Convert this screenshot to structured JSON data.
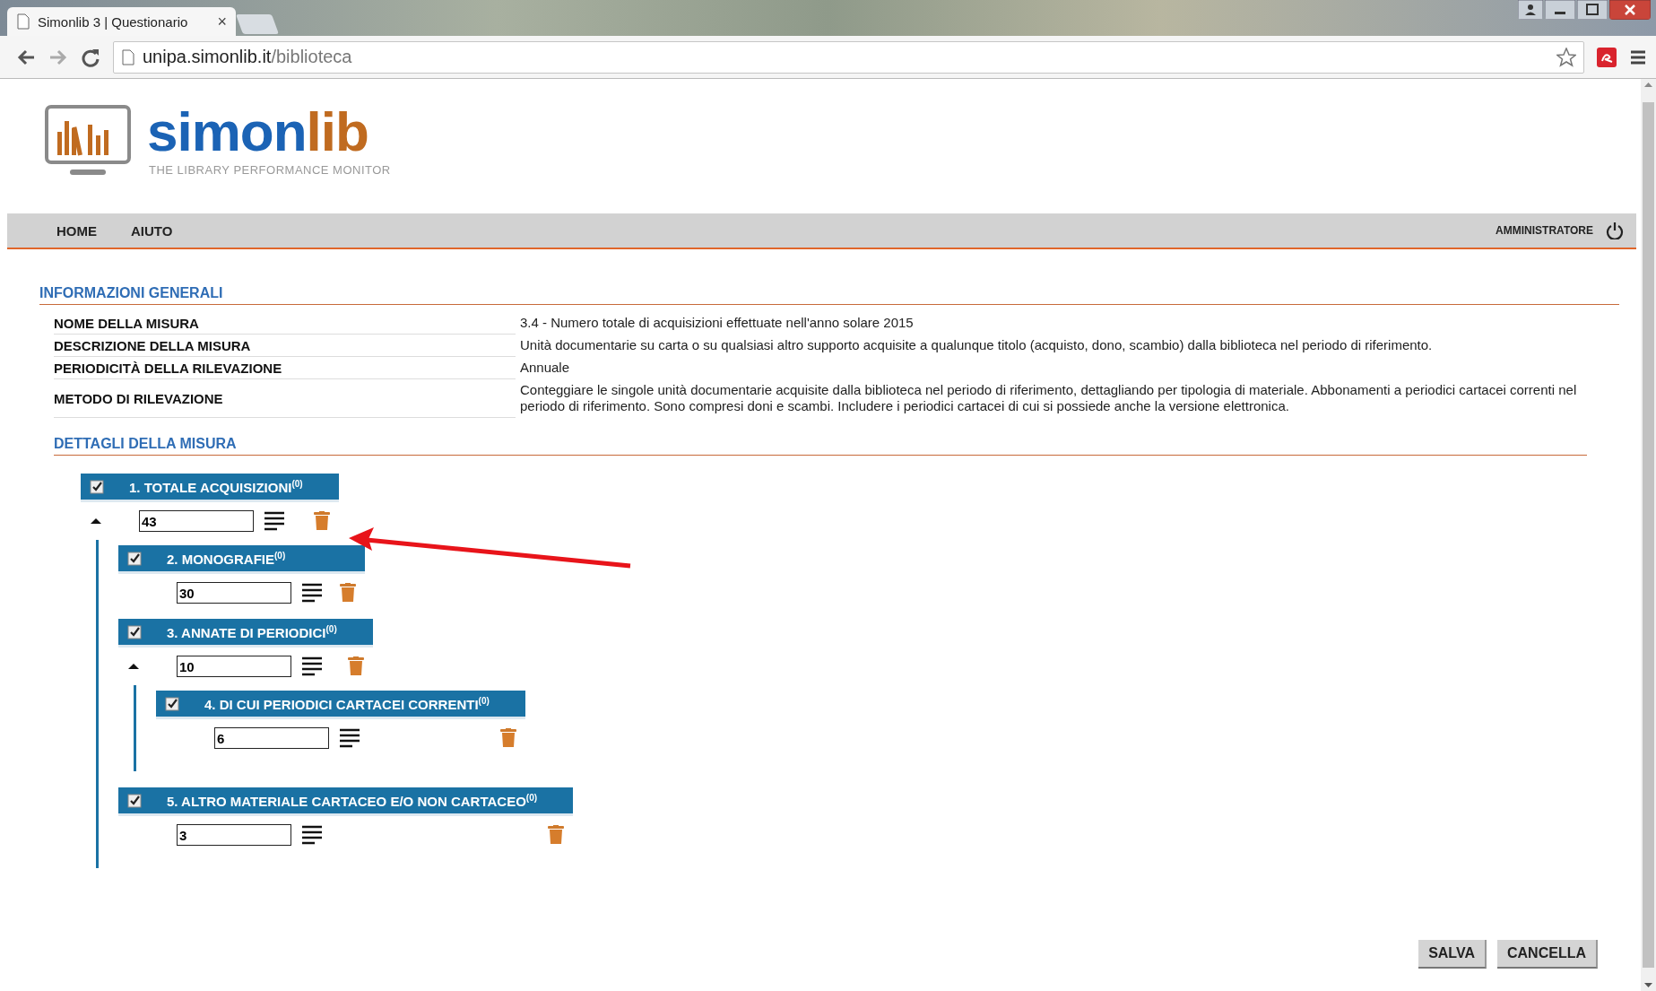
{
  "browser": {
    "tab_title": "Simonlib 3 | Questionario",
    "tab_close": "×",
    "url_host": "unipa.simonlib.it",
    "url_path": "/biblioteca"
  },
  "header": {
    "logo_primary": "simon",
    "logo_accent": "lib",
    "tagline": "THE LIBRARY PERFORMANCE MONITOR"
  },
  "nav": {
    "items": [
      "HOME",
      "AIUTO"
    ],
    "user": "AMMINISTRATORE"
  },
  "info": {
    "title": "INFORMAZIONI GENERALI",
    "rows": [
      {
        "label": "NOME DELLA MISURA",
        "value": "3.4 - Numero totale di acquisizioni effettuate nell'anno solare 2015"
      },
      {
        "label": "DESCRIZIONE DELLA MISURA",
        "value": "Unità documentarie su carta o su qualsiasi altro supporto acquisite a qualunque titolo (acquisto, dono, scambio) dalla biblioteca nel periodo di riferimento."
      },
      {
        "label": "PERIODICITÀ DELLA RILEVAZIONE",
        "value": "Annuale"
      },
      {
        "label": "METODO DI RILEVAZIONE",
        "value": "Conteggiare le singole unità documentarie acquisite dalla biblioteca nel periodo di riferimento, dettagliando per tipologia di materiale. Abbonamenti a periodici cartacei correnti nel periodo di riferimento. Sono compresi doni e scambi. Includere i periodici cartacei di cui si possiede anche la versione elettronica."
      }
    ]
  },
  "details": {
    "title": "DETTAGLI DELLA MISURA",
    "items": [
      {
        "label": "1. TOTALE ACQUISIZIONI$^{(0)}$",
        "checked": true,
        "value": "43",
        "expanded": true,
        "children": [
          {
            "label": "2. MONOGRAFIE$^{(0)}$",
            "checked": true,
            "value": "30"
          },
          {
            "label": "3. ANNATE DI PERIODICI$^{(0)}$",
            "checked": true,
            "value": "10",
            "expanded": true,
            "children": [
              {
                "label": "4. DI CUI PERIODICI CARTACEI CORRENTI$^{(0)}$",
                "checked": true,
                "value": "6"
              }
            ]
          },
          {
            "label": "5. ALTRO MATERIALE CARTACEO E/O NON CARTACEO$^{(0)}$",
            "checked": true,
            "value": "3"
          }
        ]
      }
    ]
  },
  "buttons": [
    "SALVA",
    "CANCELLA"
  ]
}
